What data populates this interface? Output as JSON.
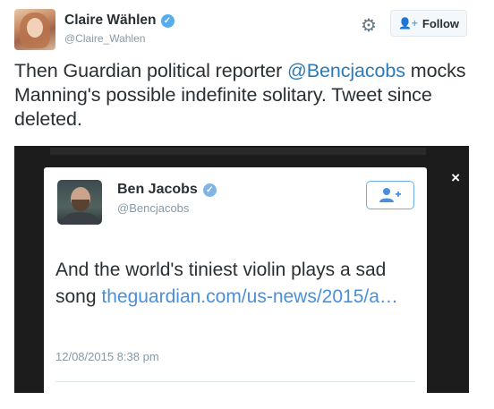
{
  "tweet": {
    "author_name": "Claire Wählen",
    "author_handle": "@Claire_Wahlen",
    "verified_glyph": "✓",
    "follow_label": "Follow",
    "follow_icon": "person-plus-icon",
    "settings_icon": "gear-icon",
    "text_before": "Then Guardian political reporter ",
    "mention": "@Bencjacobs",
    "text_after": " mocks Manning's possible indefinite solitary. Tweet since deleted."
  },
  "embedded": {
    "close_glyph": "×",
    "author_name": "Ben Jacobs",
    "author_handle": "@Bencjacobs",
    "verified_glyph": "✓",
    "follow_icon": "person-plus-icon",
    "text": "And the world's tiniest violin plays a sad song ",
    "link": "theguardian.com/us-news/2015/a…",
    "timestamp": "12/08/2015 8:38 pm"
  },
  "colors": {
    "link": "#2b7bb9",
    "verified": "#55acee",
    "text": "#292f33",
    "muted": "#8899a6"
  }
}
